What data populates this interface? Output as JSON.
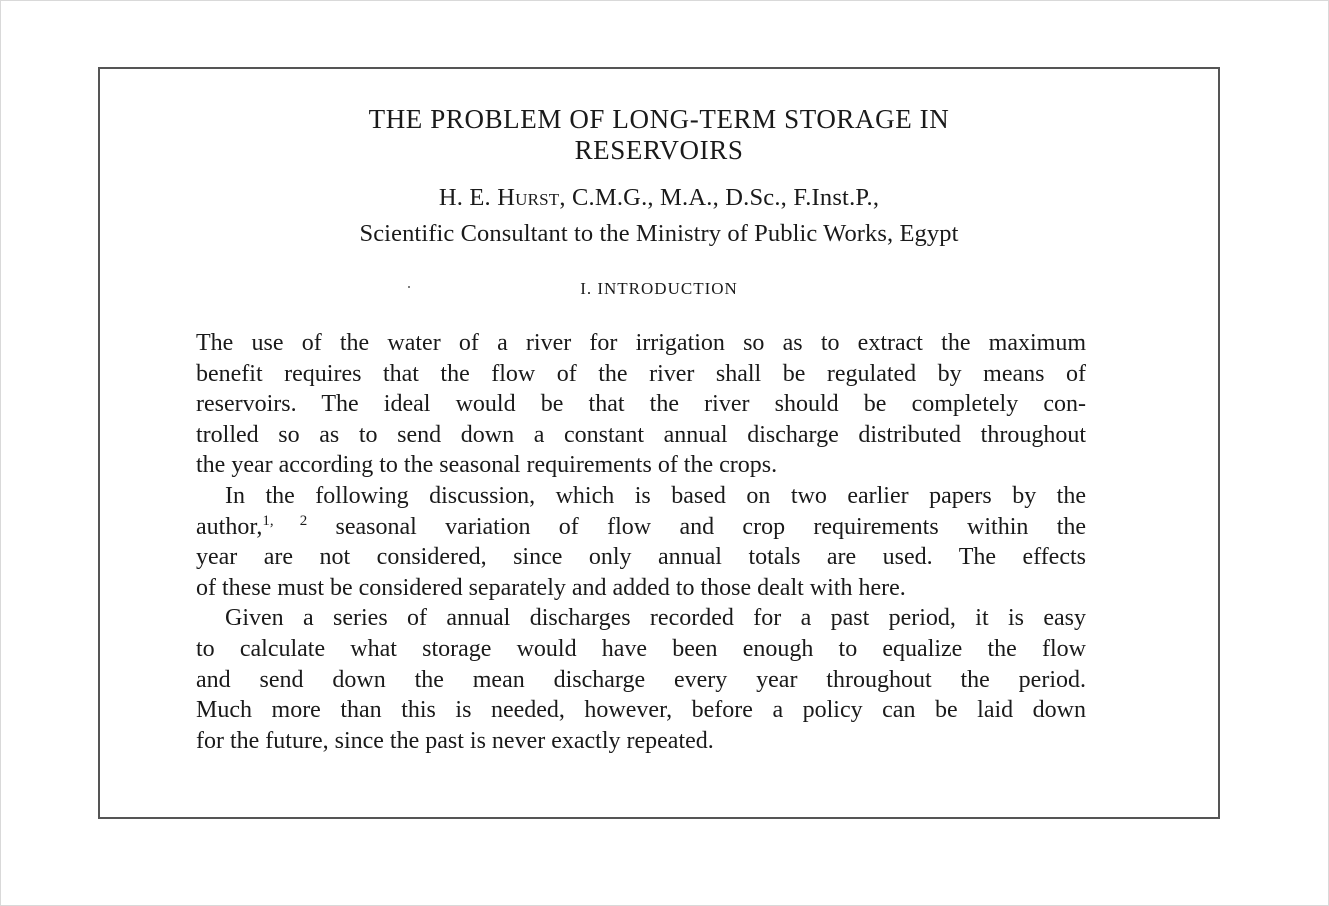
{
  "paper": {
    "title_line1": "THE PROBLEM OF LONG-TERM STORAGE IN",
    "title_line2": "RESERVOIRS",
    "author_prefix": "H. E. ",
    "author_name": "Hurst",
    "author_credentials": ", C.M.G., M.A., D.Sc., F.Inst.P.,",
    "affiliation": "Scientific Consultant to the Ministry of Public Works, Egypt",
    "section_heading": "I. INTRODUCTION",
    "paragraph1": [
      "The use of the water of a river for irrigation so as to extract the maximum",
      "benefit requires that the flow of the river shall be regulated by means of",
      "reservoirs.  The ideal would be that the river should be completely con-",
      "trolled so as to send down a constant annual discharge distributed throughout",
      "the year according to the seasonal requirements of the crops."
    ],
    "paragraph2_line1": "In the following discussion, which is based on two earlier papers by the",
    "paragraph2_line2_start": "author,",
    "paragraph2_footnote_ref": "1, 2",
    "paragraph2_line2_end": " seasonal variation of flow and crop requirements within the",
    "paragraph2_rest": [
      "year are not considered, since only annual totals are used.  The effects",
      "of these must be considered separately and added to those dealt with here."
    ],
    "paragraph3": [
      "Given a series of annual discharges recorded for a past period, it is easy",
      "to calculate what storage would have been enough to equalize the flow",
      "and send down the mean discharge every year throughout the period.",
      "Much more than this is needed, however, before a policy can be laid down",
      "for the future, since the past is never exactly repeated."
    ]
  }
}
